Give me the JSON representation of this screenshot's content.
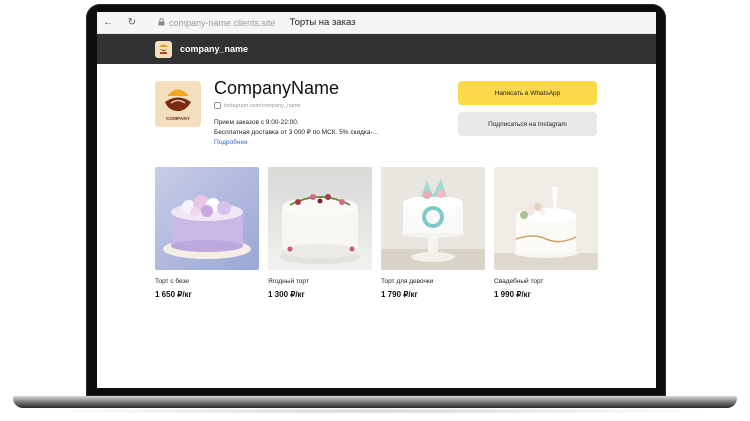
{
  "browser": {
    "url": "company-name.clients.site",
    "tab_title": "Торты на заказ"
  },
  "header": {
    "name": "company_name"
  },
  "profile": {
    "company_name": "CompanyName",
    "logo_text": "COMPANY",
    "instagram": "instagram.com/company_name",
    "hours": "Прием заказов с 9:00-22:00.",
    "delivery": "Бесплатная доставка от 3 000 ₽ по МСК. 5% скидка-...",
    "more_label": "Подробнее"
  },
  "buttons": {
    "whatsapp": "Написать в WhatsApp",
    "instagram": "Подписаться на Instagram"
  },
  "products": [
    {
      "name": "Торт с безе",
      "price": "1 650 ₽/кг"
    },
    {
      "name": "Ягодный торт",
      "price": "1 300 ₽/кг"
    },
    {
      "name": "Торт для девочки",
      "price": "1 790 ₽/кг"
    },
    {
      "name": "Свадебный торт",
      "price": "1 990 ₽/кг"
    }
  ],
  "icons": {
    "back": "arrow-left-icon",
    "reload": "reload-icon",
    "lock": "lock-icon",
    "instagram": "instagram-icon"
  },
  "colors": {
    "header_bg": "#2f3133",
    "whatsapp_button": "#fbd94b",
    "instagram_button": "#e9e9e9",
    "link": "#2c6ec8",
    "logo_bg": "#f4dfbd"
  }
}
